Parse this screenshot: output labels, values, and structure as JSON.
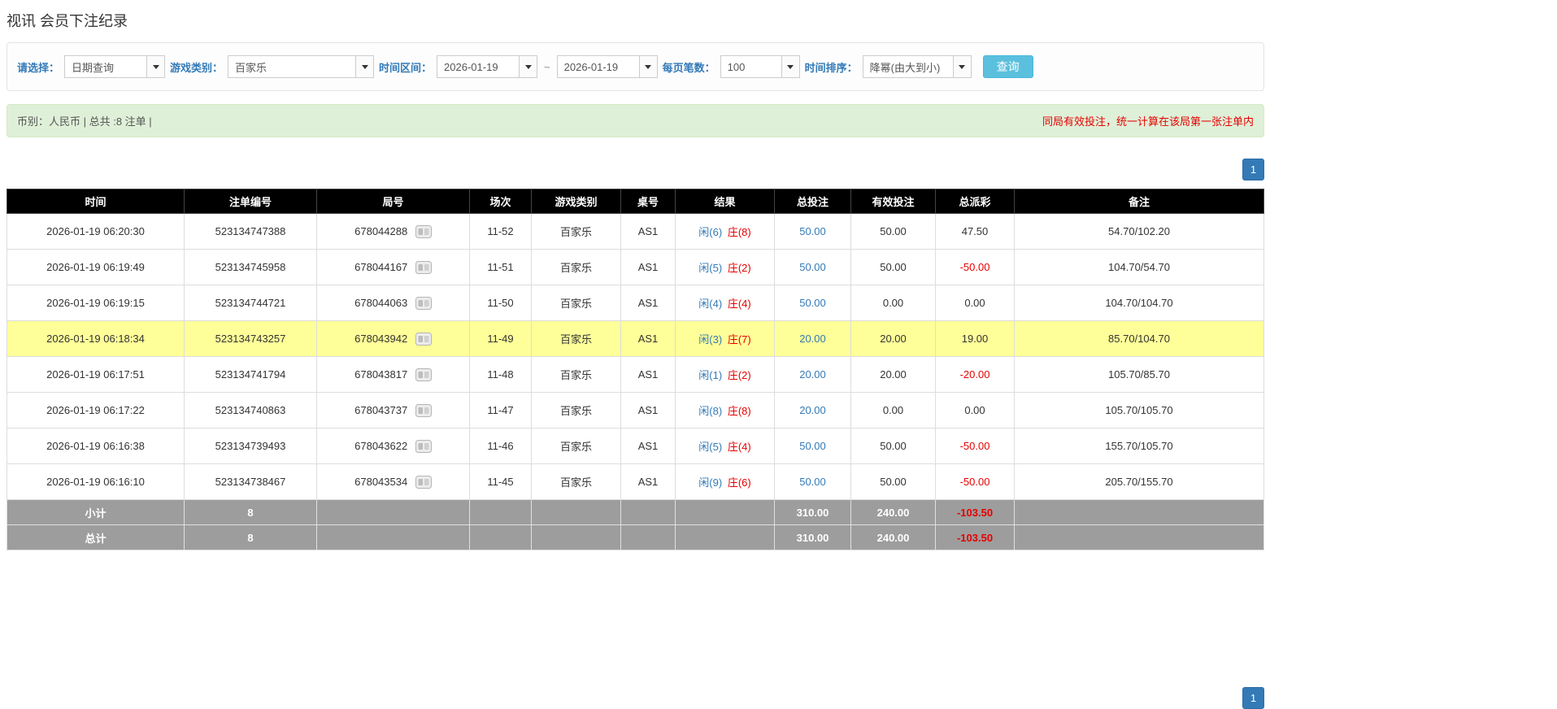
{
  "page": {
    "title": "视讯 会员下注纪录"
  },
  "filters": {
    "select_label": "请选择：",
    "select_value": "日期查询",
    "game_type_label": "游戏类别：",
    "game_type_value": "百家乐",
    "time_range_label": "时间区间：",
    "date_from": "2026-01-19",
    "date_separator": "~",
    "date_to": "2026-01-19",
    "page_size_label": "每页笔数：",
    "page_size_value": "100",
    "sort_label": "时间排序：",
    "sort_value": "降幂(由大到小)",
    "search_button": "查询"
  },
  "summary": {
    "left_text": "币别：人民币 | 总共 :8 注单 |",
    "right_notice": "同局有效投注，统一计算在该局第一张注单内"
  },
  "pagination": {
    "page": "1"
  },
  "table": {
    "headers": [
      "时间",
      "注单编号",
      "局号",
      "场次",
      "游戏类别",
      "桌号",
      "结果",
      "总投注",
      "有效投注",
      "总派彩",
      "备注"
    ],
    "rows": [
      {
        "time": "2026-01-19 06:20:30",
        "bet_id": "523134747388",
        "round": "678044288",
        "session": "11-52",
        "game": "百家乐",
        "table_no": "AS1",
        "result_player": "闲(6)",
        "result_banker": "庄(8)",
        "total_bet": "50.00",
        "valid_bet": "50.00",
        "payout": "47.50",
        "note": "54.70/102.20",
        "highlight": false
      },
      {
        "time": "2026-01-19 06:19:49",
        "bet_id": "523134745958",
        "round": "678044167",
        "session": "11-51",
        "game": "百家乐",
        "table_no": "AS1",
        "result_player": "闲(5)",
        "result_banker": "庄(2)",
        "total_bet": "50.00",
        "valid_bet": "50.00",
        "payout": "-50.00",
        "note": "104.70/54.70",
        "highlight": false
      },
      {
        "time": "2026-01-19 06:19:15",
        "bet_id": "523134744721",
        "round": "678044063",
        "session": "11-50",
        "game": "百家乐",
        "table_no": "AS1",
        "result_player": "闲(4)",
        "result_banker": "庄(4)",
        "total_bet": "50.00",
        "valid_bet": "0.00",
        "payout": "0.00",
        "note": "104.70/104.70",
        "highlight": false
      },
      {
        "time": "2026-01-19 06:18:34",
        "bet_id": "523134743257",
        "round": "678043942",
        "session": "11-49",
        "game": "百家乐",
        "table_no": "AS1",
        "result_player": "闲(3)",
        "result_banker": "庄(7)",
        "total_bet": "20.00",
        "valid_bet": "20.00",
        "payout": "19.00",
        "note": "85.70/104.70",
        "highlight": true
      },
      {
        "time": "2026-01-19 06:17:51",
        "bet_id": "523134741794",
        "round": "678043817",
        "session": "11-48",
        "game": "百家乐",
        "table_no": "AS1",
        "result_player": "闲(1)",
        "result_banker": "庄(2)",
        "total_bet": "20.00",
        "valid_bet": "20.00",
        "payout": "-20.00",
        "note": "105.70/85.70",
        "highlight": false
      },
      {
        "time": "2026-01-19 06:17:22",
        "bet_id": "523134740863",
        "round": "678043737",
        "session": "11-47",
        "game": "百家乐",
        "table_no": "AS1",
        "result_player": "闲(8)",
        "result_banker": "庄(8)",
        "total_bet": "20.00",
        "valid_bet": "0.00",
        "payout": "0.00",
        "note": "105.70/105.70",
        "highlight": false
      },
      {
        "time": "2026-01-19 06:16:38",
        "bet_id": "523134739493",
        "round": "678043622",
        "session": "11-46",
        "game": "百家乐",
        "table_no": "AS1",
        "result_player": "闲(5)",
        "result_banker": "庄(4)",
        "total_bet": "50.00",
        "valid_bet": "50.00",
        "payout": "-50.00",
        "note": "155.70/105.70",
        "highlight": false
      },
      {
        "time": "2026-01-19 06:16:10",
        "bet_id": "523134738467",
        "round": "678043534",
        "session": "11-45",
        "game": "百家乐",
        "table_no": "AS1",
        "result_player": "闲(9)",
        "result_banker": "庄(6)",
        "total_bet": "50.00",
        "valid_bet": "50.00",
        "payout": "-50.00",
        "note": "205.70/155.70",
        "highlight": false
      }
    ],
    "subtotal": {
      "label": "小计",
      "count": "8",
      "total_bet": "310.00",
      "valid_bet": "240.00",
      "payout": "-103.50"
    },
    "total": {
      "label": "总计",
      "count": "8",
      "total_bet": "310.00",
      "valid_bet": "240.00",
      "payout": "-103.50"
    }
  },
  "icons": {
    "video_icon": "video-replay-icon",
    "caret_icon": "chevron-down-icon"
  },
  "colors": {
    "accent-blue": "#337ab7",
    "search-btn-blue": "#5bc0de",
    "pager-blue": "#337ab7",
    "header-bg": "#000000",
    "footer-bg": "#9d9d9d",
    "highlight-yellow": "#ffff99",
    "player-blue": "#337ab7",
    "banker-red": "#e60000",
    "negative-red": "#e60000",
    "notice-red": "#e60000",
    "summary-bg": "#dff0d8",
    "summary-border": "#d6e9c6"
  }
}
